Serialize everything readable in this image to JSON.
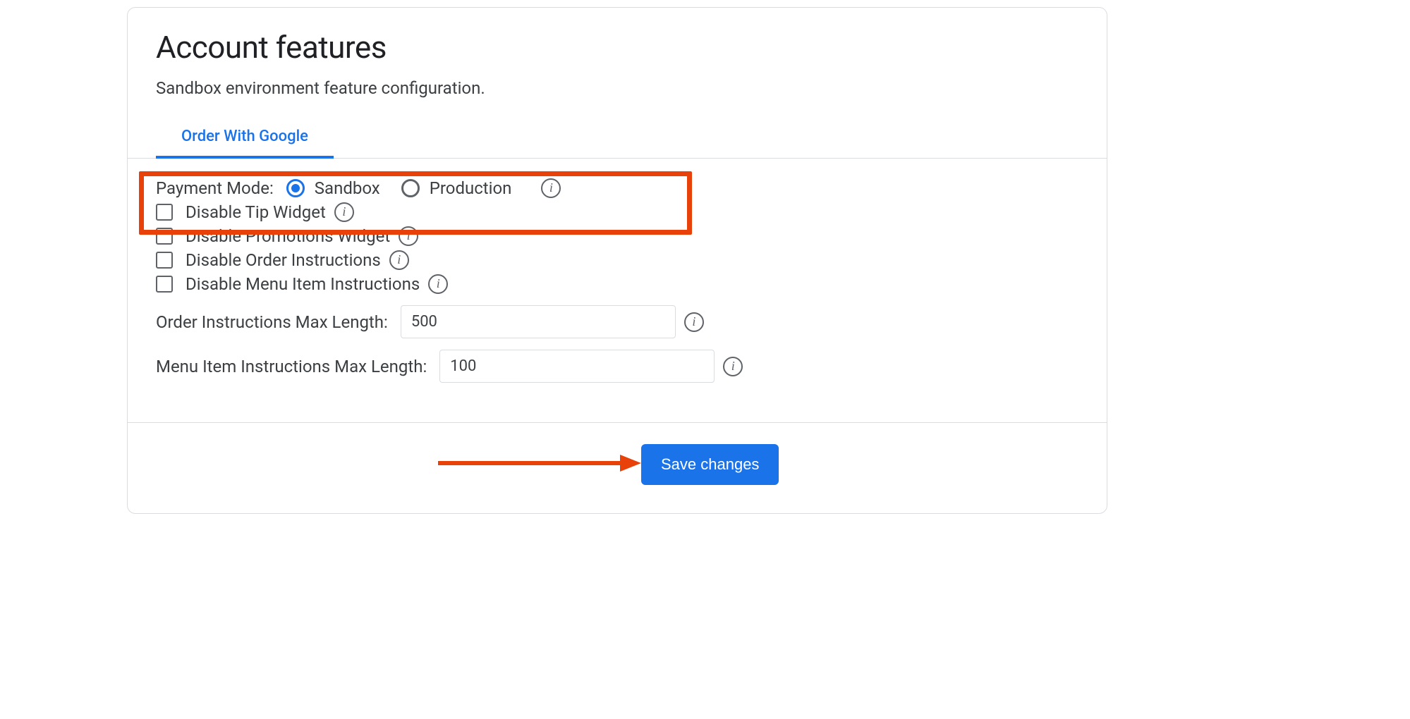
{
  "header": {
    "title": "Account features",
    "subtitle": "Sandbox environment feature configuration."
  },
  "tabs": {
    "items": [
      {
        "label": "Order With Google",
        "active": true
      }
    ]
  },
  "form": {
    "payment_mode": {
      "label": "Payment Mode:",
      "options": {
        "sandbox": "Sandbox",
        "production": "Production"
      },
      "selected": "sandbox"
    },
    "checkboxes": {
      "disable_tip_widget": "Disable Tip Widget",
      "disable_promotions_widget": "Disable Promotions Widget",
      "disable_order_instructions": "Disable Order Instructions",
      "disable_menu_item_instructions": "Disable Menu Item Instructions"
    },
    "order_instructions_max_length": {
      "label": "Order Instructions Max Length:",
      "value": "500"
    },
    "menu_item_instructions_max_length": {
      "label": "Menu Item Instructions Max Length:",
      "value": "100"
    }
  },
  "footer": {
    "save_label": "Save changes"
  },
  "annotation": {
    "highlight_box": true,
    "arrow_to_save": true
  }
}
